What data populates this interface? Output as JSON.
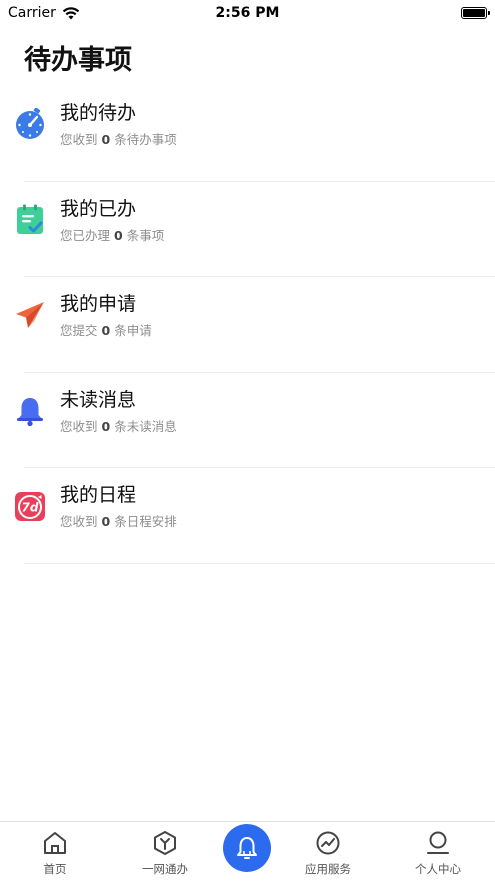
{
  "status_bar": {
    "carrier": "Carrier",
    "time": "2:56 PM"
  },
  "page": {
    "title": "待办事项"
  },
  "items": [
    {
      "title": "我的待办",
      "sub_prefix": "您收到",
      "count": "0",
      "sub_suffix": "条待办事项",
      "icon": "stopwatch-icon",
      "color": "#3b7be8"
    },
    {
      "title": "我的已办",
      "sub_prefix": "您已办理",
      "count": "0",
      "sub_suffix": "条事项",
      "icon": "clipboard-check-icon",
      "color": "#3fcf98"
    },
    {
      "title": "我的申请",
      "sub_prefix": "您提交",
      "count": "0",
      "sub_suffix": "条申请",
      "icon": "paper-plane-icon",
      "color": "#f0643c"
    },
    {
      "title": "未读消息",
      "sub_prefix": "您收到",
      "count": "0",
      "sub_suffix": "条未读消息",
      "icon": "bell-icon",
      "color": "#4a6cf0"
    },
    {
      "title": "我的日程",
      "sub_prefix": "您收到",
      "count": "0",
      "sub_suffix": "条日程安排",
      "icon": "calendar-7d-icon",
      "color": "#e8405a"
    }
  ],
  "tabs": [
    {
      "label": "首页",
      "icon": "home-icon"
    },
    {
      "label": "一网通办",
      "icon": "hexagon-y-icon"
    },
    {
      "label": "",
      "icon": "bell-icon"
    },
    {
      "label": "应用服务",
      "icon": "trend-circle-icon"
    },
    {
      "label": "个人中心",
      "icon": "person-icon"
    }
  ],
  "colors": {
    "accent": "#2c6bed",
    "divider": "#ececec"
  }
}
